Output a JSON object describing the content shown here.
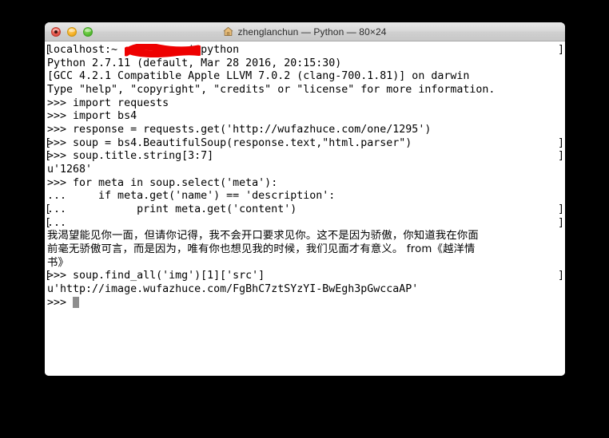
{
  "window": {
    "title": "zhenglanchun — Python — 80×24",
    "home_icon": "home-icon",
    "traffic_lights": {
      "close_label": "Close",
      "minimize_label": "Minimize",
      "zoom_label": "Zoom"
    },
    "colors": {
      "close": "#e5594d",
      "minimize": "#f7b329",
      "zoom": "#5cc036",
      "titlebar": "#d8d8d8",
      "terminal_background": "#ffffff",
      "terminal_foreground": "#000000",
      "cursor": "#8e8e8e",
      "redaction": "#ee0000"
    }
  },
  "terminal": {
    "lines": [
      {
        "text": "localhost:~           $ python",
        "marked": true,
        "redacted": true
      },
      {
        "text": "Python 2.7.11 (default, Mar 28 2016, 20:15:30)",
        "marked": false
      },
      {
        "text": "[GCC 4.2.1 Compatible Apple LLVM 7.0.2 (clang-700.1.81)] on darwin",
        "marked": false
      },
      {
        "text": "Type \"help\", \"copyright\", \"credits\" or \"license\" for more information.",
        "marked": false
      },
      {
        "text": ">>> import requests",
        "marked": false
      },
      {
        "text": ">>> import bs4",
        "marked": false
      },
      {
        "text": ">>> response = requests.get('http://wufazhuce.com/one/1295')",
        "marked": false
      },
      {
        "text": ">>> soup = bs4.BeautifulSoup(response.text,\"html.parser\")",
        "marked": true
      },
      {
        "text": ">>> soup.title.string[3:7]",
        "marked": true
      },
      {
        "text": "u'1268'",
        "marked": false
      },
      {
        "text": ">>> for meta in soup.select('meta'):",
        "marked": false
      },
      {
        "text": "...     if meta.get('name') == 'description':",
        "marked": false
      },
      {
        "text": "...           print meta.get('content')",
        "marked": true
      },
      {
        "text": "... ",
        "marked": true
      },
      {
        "text": "我渴望能见你一面，但请你记得，我不会开口要求见你。这不是因为骄傲，你知道我在你面",
        "marked": false,
        "chinese": true
      },
      {
        "text": "前毫无骄傲可言，而是因为，唯有你也想见我的时候，我们见面才有意义。 from《越洋情",
        "marked": false,
        "chinese": true
      },
      {
        "text": "书》",
        "marked": false,
        "chinese": true
      },
      {
        "text": ">>> soup.find_all('img')[1]['src']",
        "marked": true
      },
      {
        "text": "u'http://image.wufazhuce.com/FgBhC7ztSYzYI-BwEgh3pGwccaAP'",
        "marked": false
      },
      {
        "text": ">>> ",
        "marked": false,
        "cursor": true
      }
    ]
  }
}
